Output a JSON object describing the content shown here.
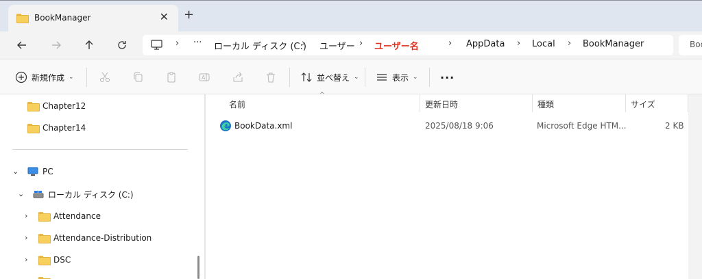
{
  "tab": {
    "title": "BookManager",
    "close": "✕",
    "new": "+"
  },
  "breadcrumb": {
    "more": "···",
    "segments": [
      "ローカル ディスク (C:)",
      "ユーザー",
      "ユーザー名",
      "AppData",
      "Local",
      "BookManager"
    ],
    "separator": "›"
  },
  "search": {
    "placeholder": "Boo"
  },
  "toolbar": {
    "new_label": "新規作成",
    "sort_label": "並べ替え",
    "view_label": "表示",
    "more": "···"
  },
  "nav": {
    "quick_items": [
      "Chapter12",
      "Chapter14"
    ],
    "pc_label": "PC",
    "drive_label": "ローカル ディスク (C:)",
    "drive_children": [
      "Attendance",
      "Attendance-Distribution",
      "DSC"
    ]
  },
  "columns": {
    "name": "名前",
    "modified": "更新日時",
    "type": "種類",
    "size": "サイズ"
  },
  "files": [
    {
      "name": "BookData.xml",
      "modified": "2025/08/18 9:06",
      "type": "Microsoft Edge HTM...",
      "size": "2 KB"
    }
  ],
  "colors": {
    "accent_red": "#e0301e",
    "folder": "#f7cf5c",
    "tabstrip": "#dfe6ef"
  }
}
